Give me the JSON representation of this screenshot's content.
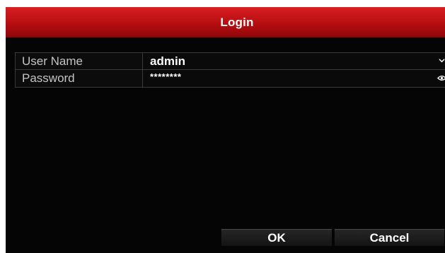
{
  "dialog": {
    "title": "Login"
  },
  "form": {
    "user_name_label": "User Name",
    "user_name_value": "admin",
    "password_label": "Password",
    "password_value": "********"
  },
  "buttons": {
    "ok_label": "OK",
    "cancel_label": "Cancel"
  },
  "icons": {
    "dropdown": "chevron-down-icon",
    "show_password": "eye-icon"
  },
  "colors": {
    "title_bar": "#c0151a",
    "background": "#050505",
    "label_text": "#c4c4c4",
    "value_text": "#ffffff"
  }
}
